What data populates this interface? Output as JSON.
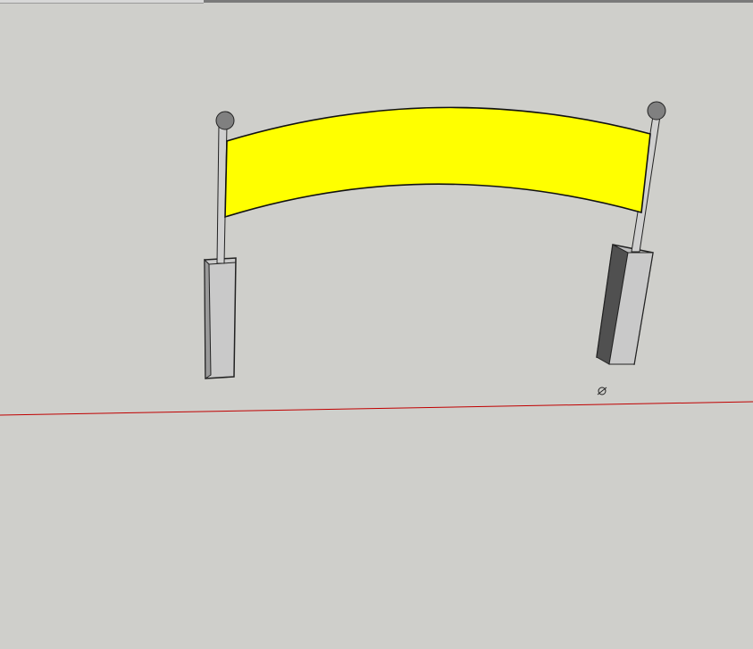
{
  "window": {
    "title": ""
  },
  "scene": {
    "background_color": "#cfcfcb",
    "banner_color": "#ffff00",
    "post_color": "#c9c9c9",
    "base_dark_color": "#555555",
    "ball_color": "#808080",
    "axis_color": "#c00000"
  },
  "icons": {
    "cursor": "orbit-cursor-icon"
  }
}
